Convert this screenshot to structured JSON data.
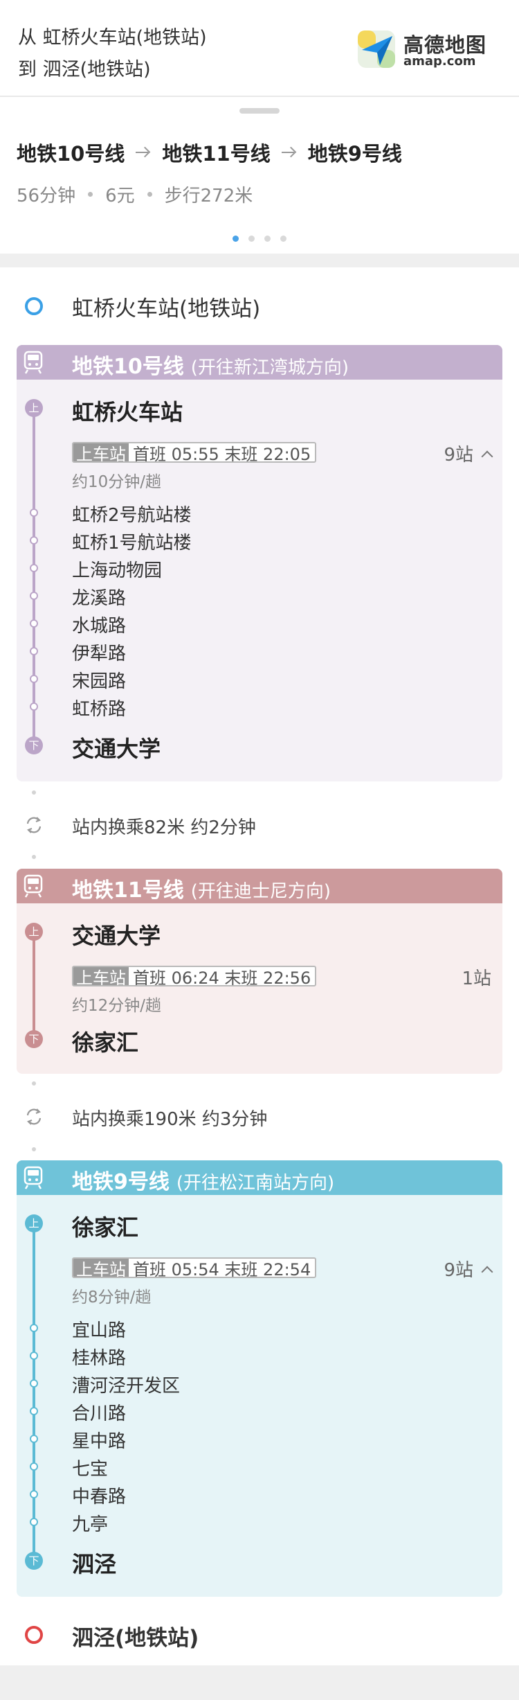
{
  "header": {
    "from_line": "从 虹桥火车站(地铁站)",
    "to_line": "到 泗泾(地铁站)",
    "logo_cn": "高德地图",
    "logo_en": "amap.com"
  },
  "summary": {
    "route_segments": [
      "地铁10号线",
      "地铁11号线",
      "地铁9号线"
    ],
    "duration": "56分钟",
    "price": "6元",
    "walk": "步行272米",
    "page_count": 4,
    "active_page": 1
  },
  "origin": {
    "name": "虹桥火车站(地铁站)"
  },
  "destination": {
    "name": "泗泾(地铁站)"
  },
  "lines": [
    {
      "name": "地铁10号线",
      "direction": "(开往新江湾城方向)",
      "head_color": "#c3b0ce",
      "body_color": "#f4f1f6",
      "line_color": "#bba5c8",
      "board_badge": "上",
      "alight_badge": "下",
      "board_station": "虹桥火车站",
      "tag_label": "上车站",
      "first_last": "首班 05:55  末班 22:05",
      "frequency": "约10分钟/趟",
      "stop_count": "9站",
      "expanded": true,
      "stops": [
        "虹桥2号航站楼",
        "虹桥1号航站楼",
        "上海动物园",
        "龙溪路",
        "水城路",
        "伊犁路",
        "宋园路",
        "虹桥路"
      ],
      "alight_station": "交通大学"
    },
    {
      "name": "地铁11号线",
      "direction": "(开往迪士尼方向)",
      "head_color": "#cc9a9c",
      "body_color": "#f8eeee",
      "line_color": "#c98e91",
      "board_badge": "上",
      "alight_badge": "下",
      "board_station": "交通大学",
      "tag_label": "上车站",
      "first_last": "首班 06:24  末班 22:56",
      "frequency": "约12分钟/趟",
      "stop_count": "1站",
      "expanded": false,
      "stops": [],
      "alight_station": "徐家汇"
    },
    {
      "name": "地铁9号线",
      "direction": "(开往松江南站方向)",
      "head_color": "#6fc3d9",
      "body_color": "#e6f4f7",
      "line_color": "#5bbad4",
      "board_badge": "上",
      "alight_badge": "下",
      "board_station": "徐家汇",
      "tag_label": "上车站",
      "first_last": "首班 05:54  末班 22:54",
      "frequency": "约8分钟/趟",
      "stop_count": "9站",
      "expanded": true,
      "stops": [
        "宜山路",
        "桂林路",
        "漕河泾开发区",
        "合川路",
        "星中路",
        "七宝",
        "中春路",
        "九亭"
      ],
      "alight_station": "泗泾"
    }
  ],
  "transfers": [
    {
      "text": "站内换乘82米 约2分钟"
    },
    {
      "text": "站内换乘190米 约3分钟"
    }
  ]
}
